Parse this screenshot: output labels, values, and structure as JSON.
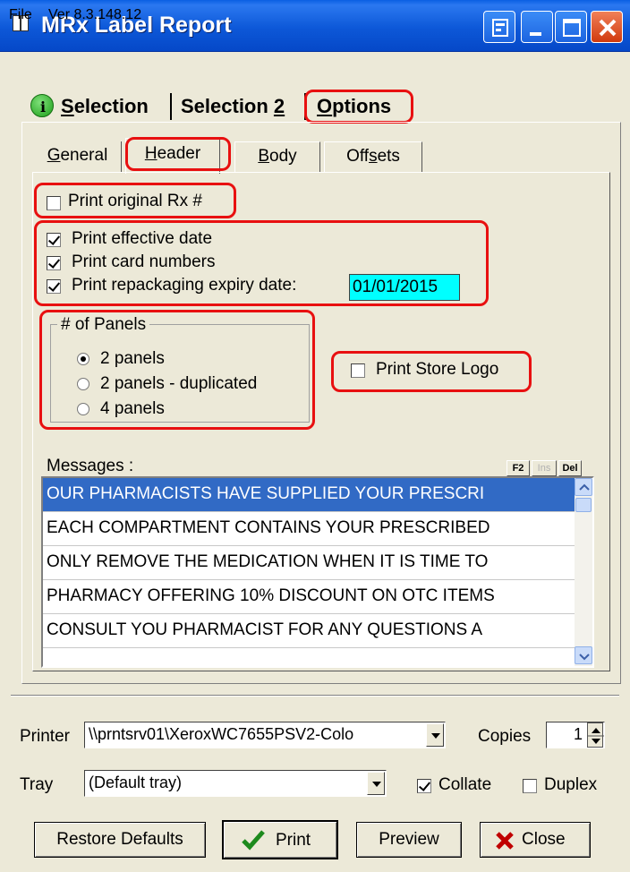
{
  "window": {
    "title": "MRx Label Report"
  },
  "menu": {
    "file": "File",
    "version": "Ver 8.3.148.12"
  },
  "main_tabs": [
    {
      "label": "Selection",
      "underline": "S"
    },
    {
      "label": "Selection 2",
      "underline": "2"
    },
    {
      "label": "Options",
      "underline": "O"
    }
  ],
  "sub_tabs": [
    "General",
    "Header",
    "Body",
    "Offsets"
  ],
  "header_options": {
    "print_original_rx": {
      "label": "Print original Rx #",
      "checked": false
    },
    "print_effective_date": {
      "label": "Print effective date",
      "checked": true
    },
    "print_card_numbers": {
      "label": "Print card numbers",
      "checked": true
    },
    "print_repackaging_expiry": {
      "label": "Print repackaging expiry date:",
      "checked": true,
      "value": "01/01/2015"
    }
  },
  "panels_group": {
    "legend": "# of Panels",
    "options": [
      "2 panels",
      "2 panels - duplicated",
      "4 panels"
    ],
    "selected": "2 panels"
  },
  "print_store_logo": {
    "label": "Print Store Logo",
    "checked": false
  },
  "messages": {
    "label": "Messages :",
    "buttons": {
      "f2": "F2",
      "ins": "Ins",
      "del": "Del"
    },
    "items": [
      "OUR PHARMACISTS HAVE SUPPLIED YOUR PRESCRI",
      "EACH COMPARTMENT CONTAINS YOUR PRESCRIBED",
      "ONLY REMOVE THE MEDICATION WHEN IT IS TIME TO",
      "PHARMACY OFFERING 10% DISCOUNT ON OTC ITEMS",
      "CONSULT YOU PHARMACIST FOR ANY QUESTIONS A"
    ]
  },
  "printer": {
    "label": "Printer",
    "value": "\\\\prntsrv01\\XeroxWC7655PSV2-Colo"
  },
  "copies": {
    "label": "Copies",
    "value": "1"
  },
  "tray": {
    "label": "Tray",
    "value": "(Default tray)"
  },
  "collate": {
    "label": "Collate",
    "checked": true
  },
  "duplex": {
    "label": "Duplex",
    "checked": false
  },
  "buttons": {
    "restore_defaults": "Restore Defaults",
    "print": "Print",
    "preview": "Preview",
    "close": "Close"
  },
  "colors": {
    "titlebar": "#0a5fe3",
    "highlight": "#e81010",
    "date_field": "#00ffff",
    "selection": "#316ac5"
  }
}
